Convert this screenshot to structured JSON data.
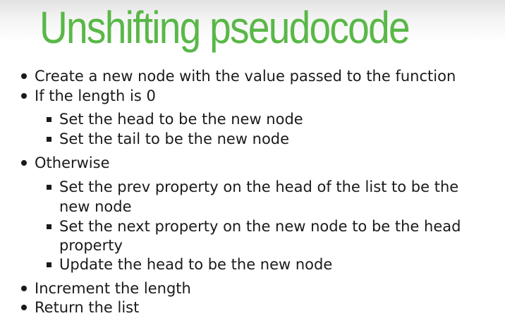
{
  "slide": {
    "title": "Unshifting pseudocode",
    "bullets": [
      "Create a new node with the value passed to the function",
      "If the length is 0",
      "Otherwise",
      "Increment the length",
      "Return the list"
    ],
    "sub_bullets_if": [
      "Set the head to be the new node",
      "Set the tail to be the new node"
    ],
    "sub_bullets_otherwise": [
      "Set the prev property on the head of the list to be the",
      "new node",
      "Set the next property on the new node to be the head",
      "property",
      "Update the head to be the new node"
    ]
  }
}
